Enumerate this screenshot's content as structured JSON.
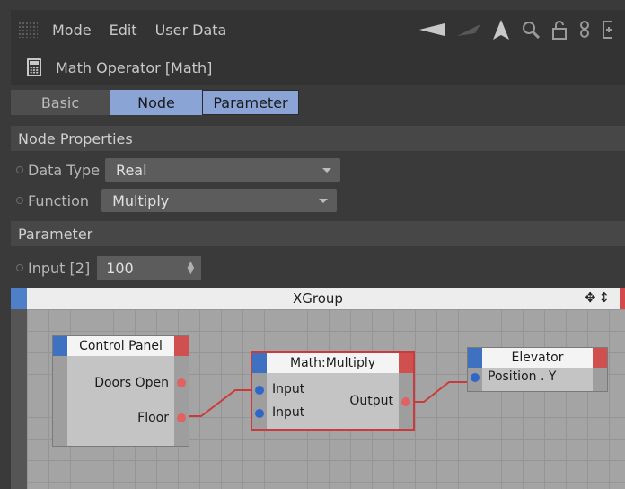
{
  "menubar": {
    "items": [
      "Mode",
      "Edit",
      "User Data"
    ],
    "icons": [
      "arrow-left-icon",
      "arrow-right-icon",
      "arrow-up-icon",
      "search-icon",
      "lock-icon",
      "link-icon",
      "new-panel-icon"
    ]
  },
  "title": "Math Operator [Math]",
  "tabs": [
    "Basic",
    "Node",
    "Parameter"
  ],
  "node_properties": {
    "header": "Node Properties",
    "data_type_label": "Data Type",
    "data_type_value": "Real",
    "function_label": "Function",
    "function_value": "Multiply"
  },
  "parameter": {
    "header": "Parameter",
    "input_label": "Input [2]",
    "input_value": "100"
  },
  "xgroup": {
    "title": "XGroup",
    "tools": "✥↕",
    "nodes": {
      "control_panel": {
        "title": "Control Panel",
        "ports_out": [
          "Doors Open",
          "Floor"
        ]
      },
      "math_multiply": {
        "title": "Math:Multiply",
        "ports_in": [
          "Input",
          "Input"
        ],
        "ports_out": [
          "Output"
        ]
      },
      "elevator": {
        "title": "Elevator",
        "ports_in": [
          "Position . Y"
        ]
      }
    }
  },
  "colors": {
    "accent_blue": "#8aa4d6",
    "port_in": "#2f67c9",
    "port_out": "#e06262",
    "wire": "#cc3b3b",
    "selected_border": "#cc3b3b"
  }
}
